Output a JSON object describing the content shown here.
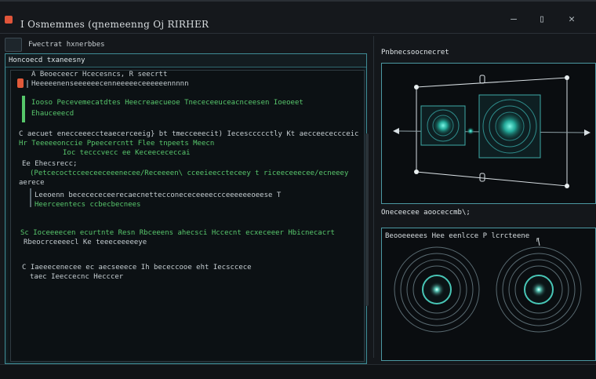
{
  "window": {
    "title": "I Osmemmes (qnemeenng Oj RIRHER",
    "controls": {
      "minimize": "—",
      "maximize": "▯",
      "close": "✕"
    }
  },
  "toolbar": {
    "label": "Fwectrat hxnerbbes"
  },
  "left_panel": {
    "header": "Honcoecd txaneesny",
    "code": {
      "lines": [
        {
          "text": "A  Beoeceecr Hcecesncs,  R  seecrtt",
          "style": "dim"
        },
        {
          "text": "Heeeeenenseeeeeecenneeeeeceeeeeennnnn",
          "style": "dim"
        },
        {
          "text": "Iooso  Pecevemecatdtes  Heecreaecueoe  Tnececeeuceacnceesen  Ioeoeet",
          "style": "green"
        },
        {
          "text": "Ehauceeecd",
          "style": "green"
        },
        {
          "text": "C  aecuet enecceeeccteaecerceeig}  bt  tmecceeecit)  Iecesccccctly  Kt  aecceececcceic",
          "style": "dim"
        },
        {
          "text": "Hr  Teeeeeonccie  Ppeecercntt  Flee  tnpeets  Meecn",
          "style": "green"
        },
        {
          "text": "Ioc  tecccvecc  ee  Keceecececcai",
          "style": "green"
        },
        {
          "text": "Ee  Ehecsrecc;",
          "style": "dim"
        },
        {
          "text": "(Petcecoctcceeceeceeenecee/Receeeen\\  cceeieeccteceey  t  riceeceeecee/ecneeey",
          "style": "green"
        },
        {
          "text": "aerece",
          "style": "dim"
        },
        {
          "text": "Leeoenn  bececececeerecaecnettecconececeeeeccceeeeeeoeese  T",
          "style": "dim"
        },
        {
          "text": "Heerceentecs  ccbecbecnees",
          "style": "green"
        },
        {
          "text": "Sc  Ioceeeecen  ecurtnte  Resn  Rbceeens  ahecsci  Hccecnt  ecxeceeer  Hbicnecacrt",
          "style": "green"
        },
        {
          "text": "Rbeocrceeeecl  Ke  teeeceeeeeye",
          "style": "dim"
        },
        {
          "text": "C  Iaeeecenecee  ec  aecseeece    Ih  bececcooe  eht  Iecsccece",
          "style": "dim"
        },
        {
          "text": "taec  Ieeccecnc  Hecccer",
          "style": "dim"
        }
      ]
    }
  },
  "right_top": {
    "label": "Pnbnecsoocnecret"
  },
  "right_bottom": {
    "label": "Oneceecee  aooceccmb\\;",
    "caption": "Beooeeeees  Hee  eenlcce  P  lcrcteene",
    "caption_right": "r"
  },
  "colors": {
    "accent_cyan": "#4b98a2",
    "code_green": "#58c76c",
    "glow": "#39d6c0",
    "brand_red": "#e0553a"
  },
  "icons": [
    "app-icon",
    "minimize-icon",
    "maximize-icon",
    "close-icon",
    "terminal-icon",
    "file-icon",
    "arrow-left-icon",
    "arrow-right-icon"
  ]
}
